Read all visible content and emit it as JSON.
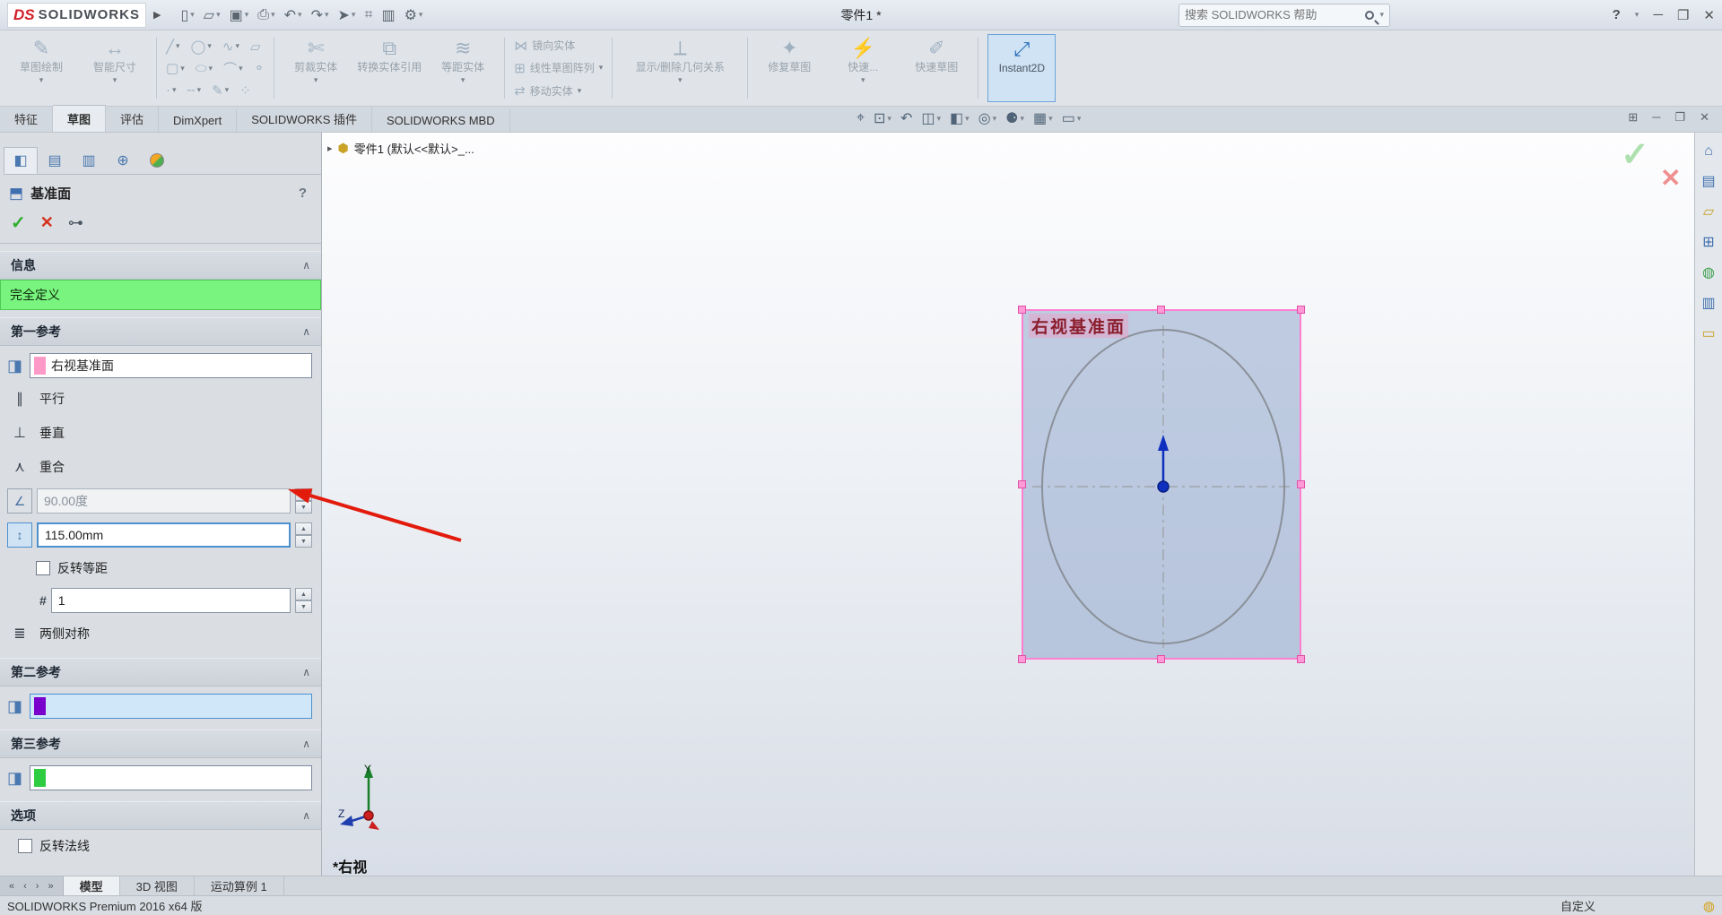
{
  "titlebar": {
    "logo_mark": "DS",
    "logo_text": "SOLIDWORKS",
    "doc_title": "零件1 *",
    "search_placeholder": "搜索 SOLIDWORKS 帮助",
    "help_label": "?"
  },
  "ribbon": {
    "sketch": "草图绘制",
    "smart_dimension": "智能尺寸",
    "trim": "剪裁实体",
    "convert": "转换实体引用",
    "offset": "等距实体",
    "mirror": "镜向实体",
    "linear_pattern": "线性草图阵列",
    "move": "移动实体",
    "relations": "显示/删除几何关系",
    "repair": "修复草图",
    "quick_snaps": "快速...",
    "rapid_sketch": "快速草图",
    "instant2d": "Instant2D"
  },
  "command_tabs": [
    "特征",
    "草图",
    "评估",
    "DimXpert",
    "SOLIDWORKS 插件",
    "SOLIDWORKS MBD"
  ],
  "property_manager": {
    "title": "基准面",
    "help": "?",
    "message_header": "信息",
    "status": "完全定义",
    "first_reference": "第一参考",
    "first_reference_value": "右视基准面",
    "parallel": "平行",
    "perpendicular": "垂直",
    "coincident": "重合",
    "angle_value": "90.00度",
    "distance_value": "115.00mm",
    "flip_offset": "反转等距",
    "plane_count": "1",
    "mid_plane": "两侧对称",
    "second_reference": "第二参考",
    "third_reference": "第三参考",
    "options_header": "选项",
    "flip_normal": "反转法线"
  },
  "viewport": {
    "tree_item": "零件1 (默认<<默认>_...",
    "plane_label": "右视基准面",
    "view_label": "*右视",
    "axis_y": "Y",
    "axis_z": "Z"
  },
  "bottom_bar": {
    "tabs": [
      "模型",
      "3D 视图",
      "运动算例 1"
    ]
  },
  "status_bar": {
    "left": "SOLIDWORKS Premium 2016 x64 版",
    "right": "自定义"
  },
  "colors": {
    "selection_pink": "#ff7fd0",
    "fully_defined_green": "#79f47e",
    "active_highlight_blue": "#cfe3f5",
    "annotation_red": "#e21b0c"
  }
}
